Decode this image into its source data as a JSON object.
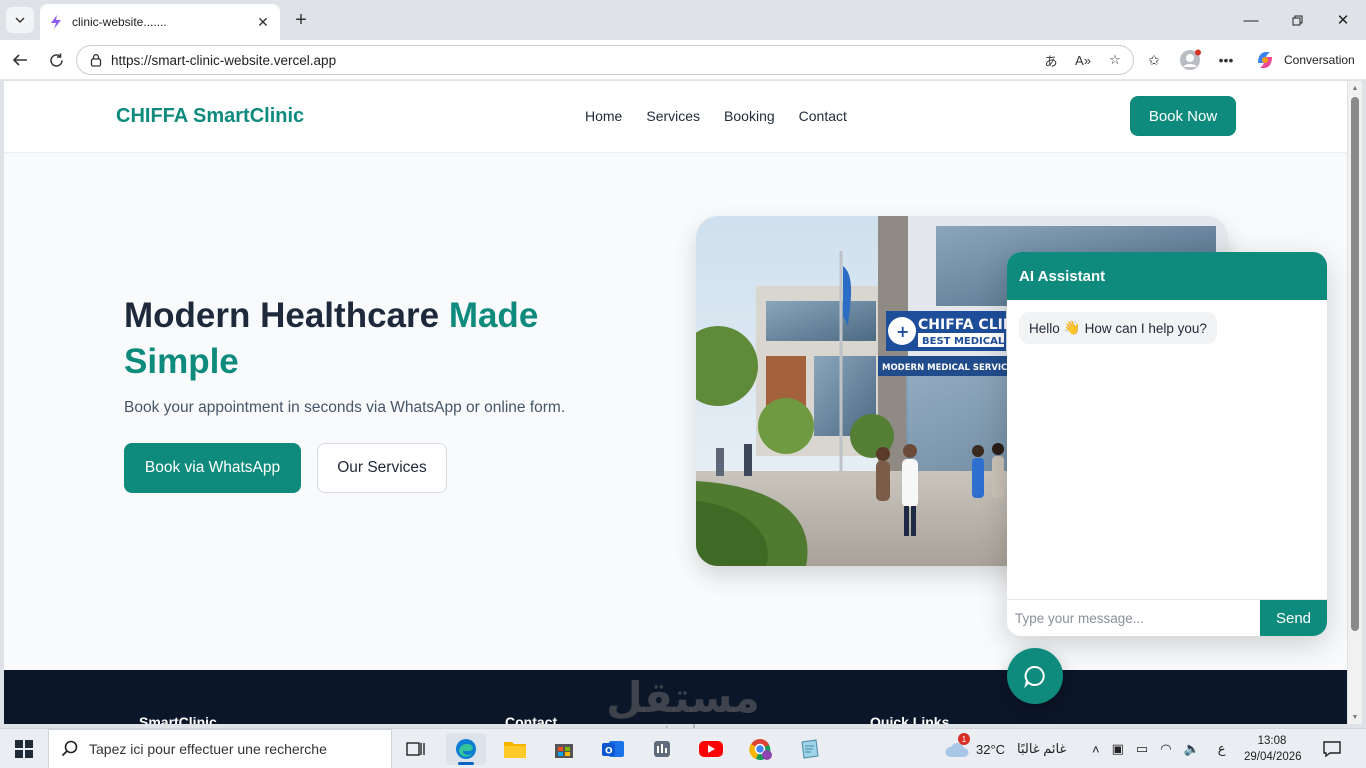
{
  "browser": {
    "tab_title": "clinic-website.......",
    "url": "https://smart-clinic-website.vercel.app",
    "copilot_label": "Conversation"
  },
  "site": {
    "logo": "CHIFFA SmartClinic",
    "nav": [
      "Home",
      "Services",
      "Booking",
      "Contact"
    ],
    "book_now": "Book Now",
    "hero": {
      "title_part1": "Modern Healthcare ",
      "title_accent": "Made Simple",
      "subtitle": "Book your appointment in seconds via WhatsApp or online form.",
      "primary_button": "Book via WhatsApp",
      "secondary_button": "Our Services"
    },
    "image_signs": {
      "line1": "CHIFFA CLINI",
      "line2": "BEST MEDICAL",
      "line3": "MODERN MEDICAL SERVICES W"
    },
    "footer_headings": [
      "SmartClinic",
      "Contact",
      "Quick Links"
    ]
  },
  "chat": {
    "title": "AI Assistant",
    "greeting_pre": "Hello",
    "greeting_emoji": "👋",
    "greeting_post": "How can I help you?",
    "input_placeholder": "Type your message...",
    "send_label": "Send"
  },
  "watermark": {
    "arabic": "مستقل",
    "latin": "mostaql.com"
  },
  "taskbar": {
    "search_placeholder": "Tapez ici pour effectuer une recherche",
    "weather_temp": "32°C",
    "weather_desc": "غائم غالبًا",
    "weather_badge": "1",
    "lang": "ع",
    "time": "13:08",
    "date": "29/04/2026"
  },
  "colors": {
    "brand": "#0f8b7e",
    "footer": "#0b1628",
    "heading": "#1e293b"
  }
}
